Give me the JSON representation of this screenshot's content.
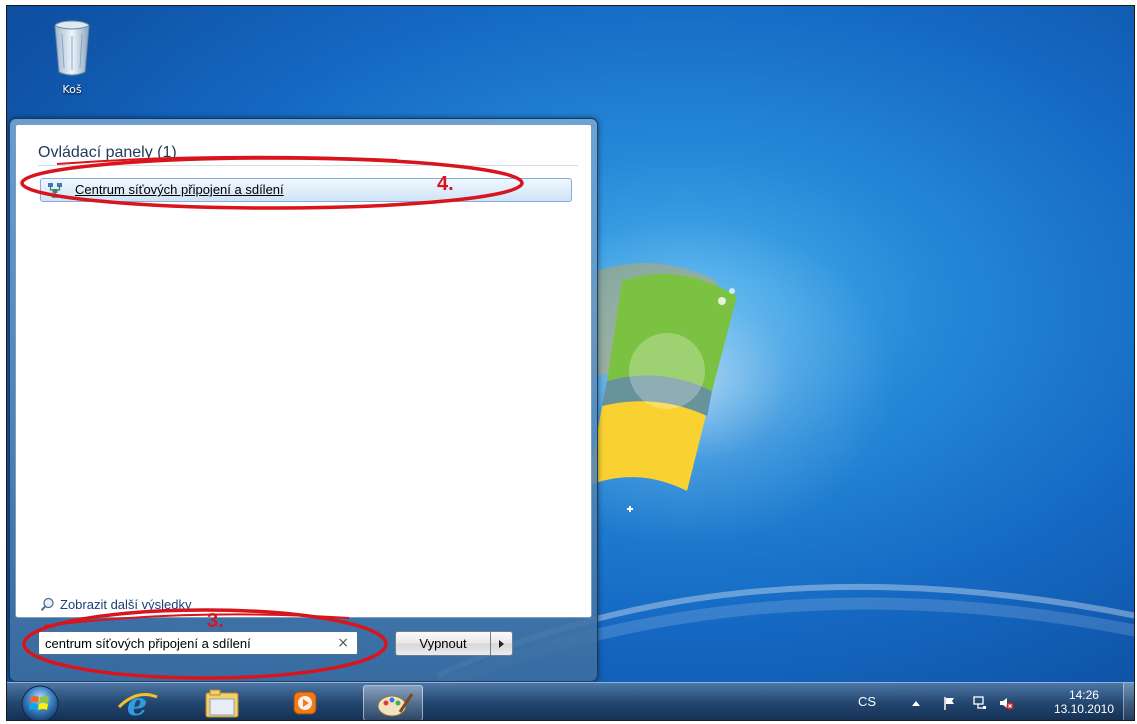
{
  "desktop": {
    "recycle_bin_label": "Koš"
  },
  "start_menu": {
    "group_title": "Ovládací panely (1)",
    "result_item_label": "Centrum síťových připojení a sdílení",
    "more_results_label": "Zobrazit další výsledky",
    "search_value": "centrum síťových připojení a sdílení",
    "clear_icon": "×",
    "shutdown_label": "Vypnout"
  },
  "annotations": {
    "step_search": "3.",
    "step_result": "4.",
    "color": "#d8141c"
  },
  "taskbar": {
    "pinned": [
      "internet-explorer-icon",
      "windows-explorer-icon",
      "media-player-icon",
      "paint-icon"
    ],
    "language": "CS",
    "time": "14:26",
    "date": "13.10.2010"
  }
}
